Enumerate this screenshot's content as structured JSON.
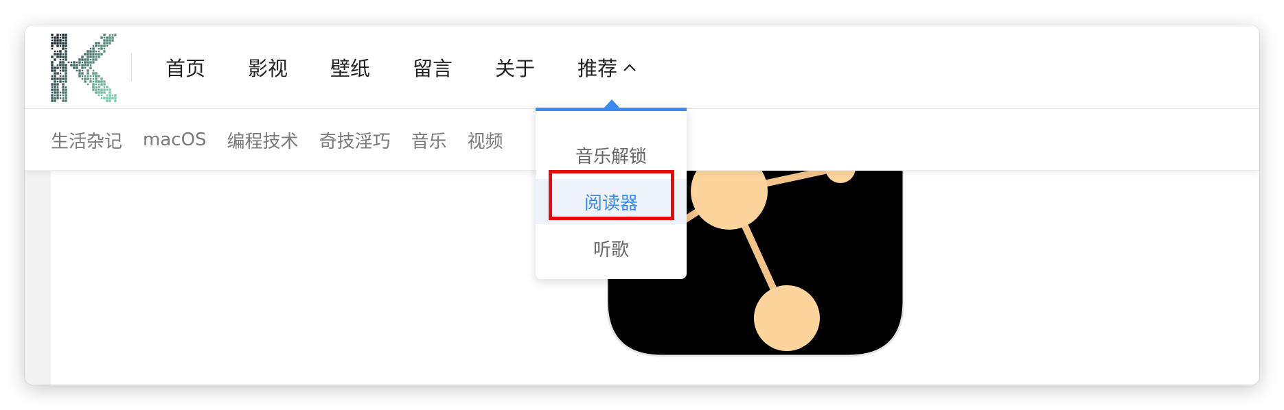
{
  "colors": {
    "accent": "#3a8bed",
    "highlight": "#e8090d",
    "icon_background": "#000000",
    "icon_nodes": "#fdd49c"
  },
  "header": {
    "logo_icon": "k-pixel-logo",
    "nav": [
      {
        "label": "首页"
      },
      {
        "label": "影视"
      },
      {
        "label": "壁纸"
      },
      {
        "label": "留言"
      },
      {
        "label": "关于"
      },
      {
        "label": "推荐",
        "icon": "chevron-up-icon"
      }
    ]
  },
  "categories": [
    "生活杂记",
    "macOS",
    "编程技术",
    "奇技淫巧",
    "音乐",
    "视频"
  ],
  "dropdown": {
    "items": [
      {
        "label": "音乐解锁",
        "active": false
      },
      {
        "label": "阅读器",
        "active": true
      },
      {
        "label": "听歌",
        "active": false
      }
    ]
  },
  "content": {
    "app_icon": "molecule-network-icon"
  }
}
